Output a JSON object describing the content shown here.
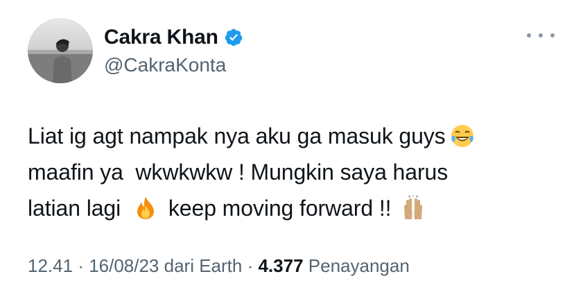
{
  "author": {
    "display_name": "Cakra Khan",
    "handle": "@CakraKonta",
    "verified_icon": "verified-badge-icon",
    "avatar_icon": "profile-avatar"
  },
  "more_icon": "more-options-icon",
  "tweet": {
    "line1_text": "Liat ig agt nampak nya aku ga masuk guys",
    "line1_emoji": "face-with-tears-of-joy-emoji",
    "line2_text": "maafin ya  wkwkwkw ! Mungkin saya harus",
    "line3_text_a": "latian lagi",
    "line3_emoji_a": "fire-emoji",
    "line3_text_b": " keep moving forward !!",
    "line3_emoji_b": "raising-hands-emoji"
  },
  "meta": {
    "time": "12.41",
    "sep1": " · ",
    "date": "16/08/23",
    "source": " dari Earth",
    "sep2": " · ",
    "views_count": "4.377",
    "views_label": " Penayangan"
  },
  "colors": {
    "text": "#0f1419",
    "secondary": "#536471",
    "verified": "#1d9bf0"
  }
}
